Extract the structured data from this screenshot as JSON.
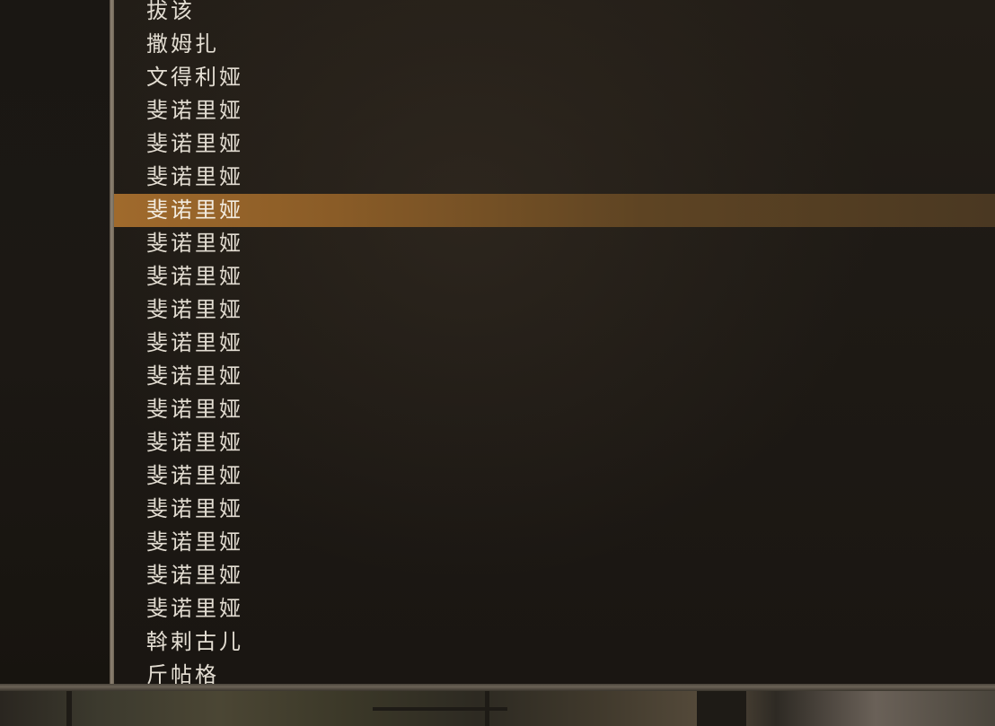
{
  "name_list": {
    "items": [
      "拔该",
      "撒姆扎",
      "文得利娅",
      "斐诺里娅",
      "斐诺里娅",
      "斐诺里娅",
      "斐诺里娅",
      "斐诺里娅",
      "斐诺里娅",
      "斐诺里娅",
      "斐诺里娅",
      "斐诺里娅",
      "斐诺里娅",
      "斐诺里娅",
      "斐诺里娅",
      "斐诺里娅",
      "斐诺里娅",
      "斐诺里娅",
      "斐诺里娅",
      "斡剌古儿",
      "斤帖格"
    ],
    "selected_index": 6
  },
  "colors": {
    "row_text": "#e3ddd2",
    "selection_highlight": "#a06a2c",
    "divider": "#8f8474"
  }
}
